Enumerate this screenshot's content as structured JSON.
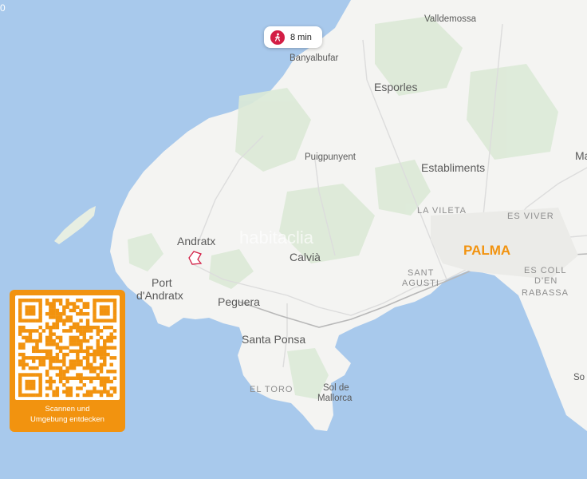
{
  "map": {
    "places": [
      {
        "id": "valldemossa",
        "name": "Valldemossa"
      },
      {
        "id": "banyalbufar",
        "name": "Banyalbufar"
      },
      {
        "id": "esporles",
        "name": "Esporles"
      },
      {
        "id": "puigpunyent",
        "name": "Puigpunyent"
      },
      {
        "id": "establiments",
        "name": "Establiments"
      },
      {
        "id": "la-vileta",
        "name": "LA VILETA"
      },
      {
        "id": "es-viver",
        "name": "ES VIVER"
      },
      {
        "id": "palma",
        "name": "PALMA"
      },
      {
        "id": "andratx",
        "name": "Andratx"
      },
      {
        "id": "calvia",
        "name": "Calvià"
      },
      {
        "id": "sant-agusti-1",
        "name": "SANT"
      },
      {
        "id": "sant-agusti-2",
        "name": "AGUSTI"
      },
      {
        "id": "es-coll-1",
        "name": "ES COLL"
      },
      {
        "id": "es-coll-2",
        "name": "D'EN"
      },
      {
        "id": "es-coll-3",
        "name": "RABASSA"
      },
      {
        "id": "port-andratx-1",
        "name": "Port"
      },
      {
        "id": "port-andratx-2",
        "name": "d'Andratx"
      },
      {
        "id": "peguera",
        "name": "Peguera"
      },
      {
        "id": "santa-ponsa",
        "name": "Santa Ponsa"
      },
      {
        "id": "el-toro",
        "name": "EL TORO"
      },
      {
        "id": "sol-1",
        "name": "Sol de"
      },
      {
        "id": "sol-2",
        "name": "Mallorca"
      },
      {
        "id": "edge-ma",
        "name": "Ma"
      },
      {
        "id": "edge-so",
        "name": "So"
      }
    ],
    "watermark": "habitaclia",
    "corner_label": "0",
    "colors": {
      "sea": "#a8c9ec",
      "land": "#f4f4f2",
      "park": "#d9e8d4",
      "accent": "#f2930f",
      "marker": "#d31e45"
    }
  },
  "travel_time": {
    "icon": "walking-person-icon",
    "label": "8 min"
  },
  "qr_card": {
    "caption_line1": "Scannen und",
    "caption_line2": "Umgebung entdecken"
  }
}
